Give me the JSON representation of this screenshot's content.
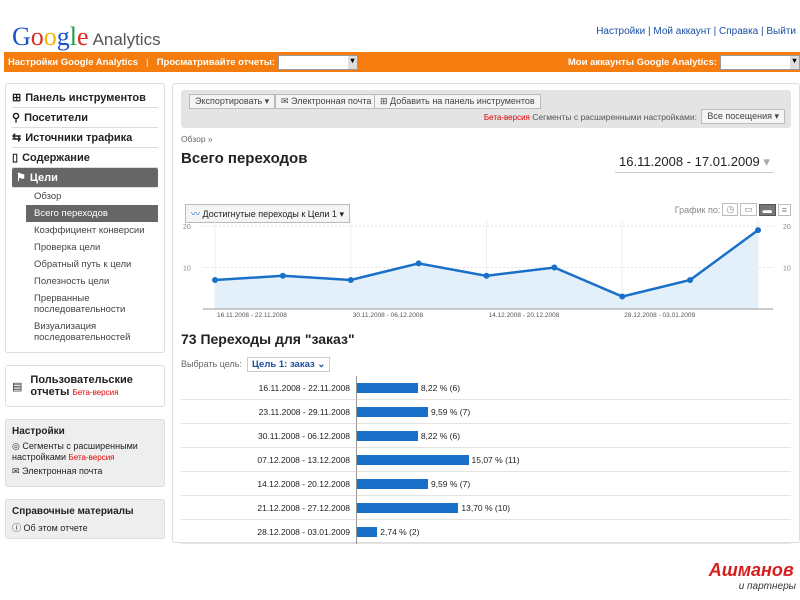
{
  "header": {
    "logo": "Google Analytics",
    "links": [
      "Настройки",
      "Мой аккаунт",
      "Справка",
      "Выйти"
    ]
  },
  "orangebar": {
    "settings": "Настройки Google Analytics",
    "view_reports": "Просматривайте отчеты:",
    "my_accounts": "Мои аккаунты Google Analytics:"
  },
  "sidebar": {
    "items": [
      {
        "label": "Панель инструментов",
        "icon": "dashboard-icon"
      },
      {
        "label": "Посетители",
        "icon": "person-icon"
      },
      {
        "label": "Источники трафика",
        "icon": "traffic-icon"
      },
      {
        "label": "Содержание",
        "icon": "page-icon"
      },
      {
        "label": "Цели",
        "icon": "flag-icon"
      }
    ],
    "goals_sub": [
      "Обзор",
      "Всего переходов",
      "Коэффициент конверсии",
      "Проверка цели",
      "Обратный путь к цели",
      "Полезность цели",
      "Прерванные последовательности",
      "Визуализация последовательностей"
    ],
    "custom_reports": "Пользовательские отчеты",
    "beta": "Бета-версия",
    "settings_title": "Настройки",
    "settings_items": [
      "Сегменты с расширенными настройками",
      "Электронная почта"
    ],
    "help_title": "Справочные материалы",
    "help_items": [
      "Об этом отчете"
    ]
  },
  "toolbar": {
    "export": "Экспортировать",
    "email": "Электронная почта",
    "add_dashboard": "Добавить на панель инструментов",
    "beta": "Бета-версия",
    "segments_label": "Сегменты с расширенными настройками:",
    "segments_value": "Все посещения"
  },
  "breadcrumb": "Обзор »",
  "title": "Всего переходов",
  "date_range": "16.11.2008 - 17.01.2009",
  "chart_controls": {
    "metric": "Достигнутые переходы к Цели 1",
    "graph_by": "График по:"
  },
  "chart_data": [
    {
      "type": "area",
      "y_ticks": [
        10,
        20
      ],
      "ylim": [
        0,
        20
      ],
      "x_tick_labels": [
        "16.11.2008 - 22.11.2008",
        "30.11.2008 - 06.12.2008",
        "14.12.2008 - 20.12.2008",
        "28.12.2008 - 03.01.2009"
      ],
      "values": [
        7,
        8,
        7,
        11,
        8,
        10,
        3,
        7,
        19
      ],
      "color": "#1a70c8",
      "grid": true
    },
    {
      "type": "bar",
      "title": "73 Переходы для \"заказ\"",
      "categories": [
        "16.11.2008 - 22.11.2008",
        "23.11.2008 - 29.11.2008",
        "30.11.2008 - 06.12.2008",
        "07.12.2008 - 13.12.2008",
        "14.12.2008 - 20.12.2008",
        "21.12.2008 - 27.12.2008",
        "28.12.2008 - 03.01.2009"
      ],
      "percent": [
        8.22,
        9.59,
        8.22,
        15.07,
        9.59,
        13.7,
        2.74
      ],
      "labels": [
        "8,22 % (6)",
        "9,59 % (7)",
        "8,22 % (6)",
        "15,07 % (11)",
        "9,59 % (7)",
        "13,70 % (10)",
        "2,74 % (2)"
      ],
      "values": [
        6,
        7,
        6,
        11,
        7,
        10,
        2
      ],
      "color": "#1a70c8"
    }
  ],
  "goal_select": {
    "label": "Выбрать цель:",
    "value": "Цель 1: заказ"
  },
  "watermark": "Ашманов и партнеры"
}
